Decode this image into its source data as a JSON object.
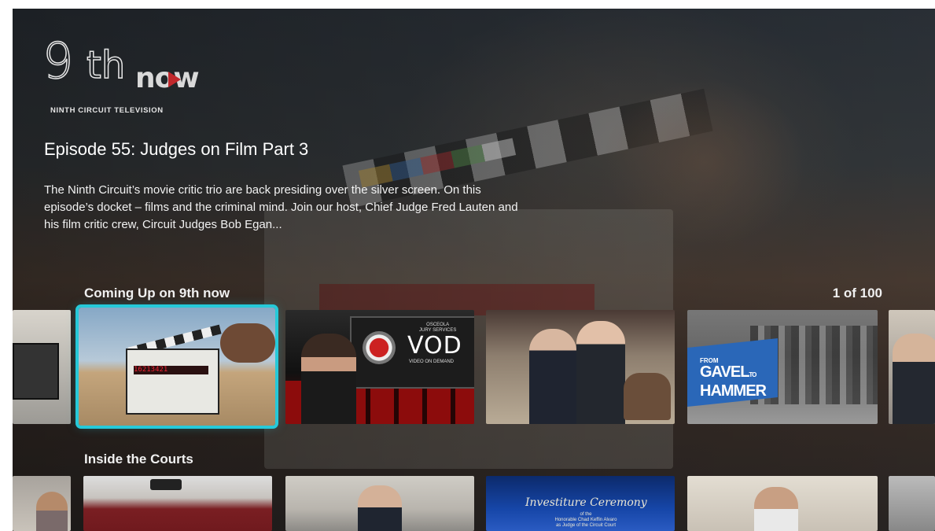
{
  "app": {
    "logo": {
      "main": "9th",
      "now": "now",
      "tagline": "NINTH CIRCUIT TELEVISION"
    }
  },
  "featured": {
    "title": "Episode 55: Judges on Film Part 3",
    "description": "The Ninth Circuit’s movie critic trio are back presiding over the silver screen. On this episode’s docket – films and the criminal mind. Join our host, Chief Judge Fred Lauten and his film critic crew, Circuit Judges Bob Egan..."
  },
  "rows": [
    {
      "label": "Coming Up on 9th now",
      "counter": "1 of 100",
      "tiles": [
        {
          "name": "studio-monitor-thumbnail"
        },
        {
          "name": "judges-on-film-3-thumbnail",
          "focused": true,
          "slate_code": "16213421"
        },
        {
          "name": "osceola-jury-services-vod-thumbnail",
          "vod_text": "VOD",
          "vod_sub": "VIDEO ON DEMAND",
          "osceola": "OSCEOLA",
          "jury": "JURY SERVICES"
        },
        {
          "name": "judges-portrait-thumbnail"
        },
        {
          "name": "from-gavel-to-hammer-thumbnail",
          "from": "FROM",
          "gavel": "GAVEL",
          "to": "TO",
          "hammer": "HAMMER"
        },
        {
          "name": "judge-portrait-edge-thumbnail"
        }
      ]
    },
    {
      "label": "Inside the Courts",
      "tiles": [
        {
          "name": "woman-presenter-thumbnail"
        },
        {
          "name": "courtroom-ceremony-thumbnail"
        },
        {
          "name": "man-at-podium-thumbnail"
        },
        {
          "name": "investiture-ceremony-thumbnail",
          "title": "Investiture Ceremony",
          "line1": "of the",
          "line2": "Honorable Chad Keffin Alvaro",
          "line3": "as Judge of the Circuit Court"
        },
        {
          "name": "man-speaking-thumbnail"
        },
        {
          "name": "edge-thumbnail"
        }
      ]
    }
  ],
  "colors": {
    "focus": "#26c9d9",
    "text": "#ffffff"
  }
}
